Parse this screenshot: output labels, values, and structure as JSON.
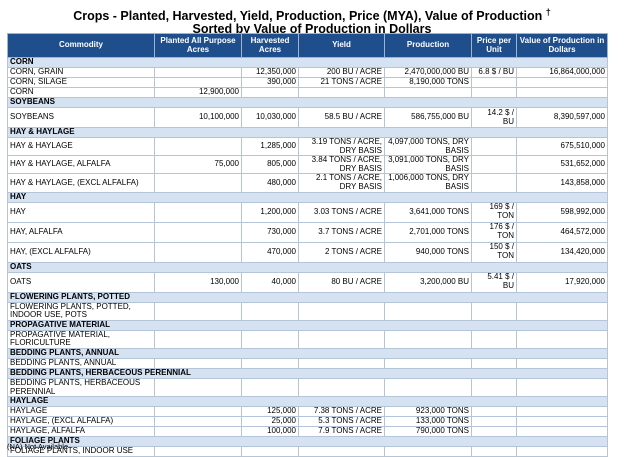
{
  "title_line1": "Crops - Planted, Harvested, Yield, Production, Price (MYA), Value of Production",
  "title_mark": "†",
  "title_line2": "Sorted by Value of Production in Dollars",
  "columns": [
    "Commodity",
    "Planted All Purpose Acres",
    "Harvested Acres",
    "Yield",
    "Production",
    "Price per Unit",
    "Value of Production in Dollars"
  ],
  "rows": [
    {
      "type": "section",
      "label": "CORN"
    },
    {
      "type": "data",
      "h": "h9",
      "cells": [
        "CORN, GRAIN",
        "",
        "12,350,000",
        "200 BU / ACRE",
        "2,470,000,000 BU",
        "6.8 $ / BU",
        "16,864,000,000"
      ]
    },
    {
      "type": "data",
      "h": "h9",
      "cells": [
        "CORN, SILAGE",
        "",
        "390,000",
        "21 TONS / ACRE",
        "8,190,000 TONS",
        "",
        ""
      ]
    },
    {
      "type": "data",
      "h": "h9",
      "cells": [
        "CORN",
        "12,900,000",
        "",
        "",
        "",
        "",
        ""
      ]
    },
    {
      "type": "section",
      "label": "SOYBEANS"
    },
    {
      "type": "data",
      "h": "h19",
      "cells": [
        "SOYBEANS",
        "10,100,000",
        "10,030,000",
        "58.5 BU / ACRE",
        "586,755,000 BU",
        "14.2 $ / BU",
        "8,390,597,000"
      ]
    },
    {
      "type": "section",
      "label": "HAY & HAYLAGE"
    },
    {
      "type": "data",
      "h": "h16",
      "cells": [
        "HAY & HAYLAGE",
        "",
        "1,285,000",
        "3.19 TONS / ACRE, DRY BASIS",
        "4,097,000 TONS, DRY BASIS",
        "",
        "675,510,000"
      ]
    },
    {
      "type": "data",
      "h": "h16",
      "cells": [
        "HAY & HAYLAGE, ALFALFA",
        "75,000",
        "805,000",
        "3.84 TONS / ACRE, DRY BASIS",
        "3,091,000 TONS, DRY BASIS",
        "",
        "531,652,000"
      ]
    },
    {
      "type": "data",
      "h": "h16",
      "cells": [
        "HAY & HAYLAGE, (EXCL ALFALFA)",
        "",
        "480,000",
        "2.1 TONS / ACRE, DRY BASIS",
        "1,006,000 TONS, DRY BASIS",
        "",
        "143,858,000"
      ]
    },
    {
      "type": "section",
      "label": "HAY"
    },
    {
      "type": "data",
      "h": "h19",
      "cells": [
        "HAY",
        "",
        "1,200,000",
        "3.03 TONS / ACRE",
        "3,641,000 TONS",
        "169 $ / TON",
        "598,992,000"
      ]
    },
    {
      "type": "data",
      "h": "h19",
      "cells": [
        "HAY, ALFALFA",
        "",
        "730,000",
        "3.7 TONS / ACRE",
        "2,701,000 TONS",
        "176 $ / TON",
        "464,572,000"
      ]
    },
    {
      "type": "data",
      "h": "h19",
      "cells": [
        "HAY, (EXCL ALFALFA)",
        "",
        "470,000",
        "2 TONS / ACRE",
        "940,000 TONS",
        "150 $ / TON",
        "134,420,000"
      ]
    },
    {
      "type": "section",
      "label": "OATS"
    },
    {
      "type": "data",
      "h": "h19",
      "cells": [
        "OATS",
        "130,000",
        "40,000",
        "80 BU / ACRE",
        "3,200,000 BU",
        "5.41 $ / BU",
        "17,920,000"
      ]
    },
    {
      "type": "section",
      "label": "FLOWERING PLANTS, POTTED"
    },
    {
      "type": "data",
      "h": "h16",
      "cells": [
        "FLOWERING PLANTS, POTTED, INDOOR USE, POTS",
        "",
        "",
        "",
        "",
        "",
        ""
      ]
    },
    {
      "type": "section",
      "label": "PROPAGATIVE MATERIAL"
    },
    {
      "type": "data",
      "h": "h16",
      "cells": [
        "PROPAGATIVE MATERIAL, FLORICULTURE",
        "",
        "",
        "",
        "",
        "",
        ""
      ]
    },
    {
      "type": "section",
      "label": "BEDDING PLANTS, ANNUAL"
    },
    {
      "type": "data",
      "h": "h9",
      "cells": [
        "BEDDING PLANTS, ANNUAL",
        "",
        "",
        "",
        "",
        "",
        ""
      ]
    },
    {
      "type": "section",
      "label": "BEDDING PLANTS, HERBACEOUS PERENNIAL"
    },
    {
      "type": "data",
      "h": "h16",
      "cells": [
        "BEDDING PLANTS, HERBACEOUS PERENNIAL",
        "",
        "",
        "",
        "",
        "",
        ""
      ]
    },
    {
      "type": "section",
      "label": "HAYLAGE"
    },
    {
      "type": "data",
      "h": "h9",
      "cells": [
        "HAYLAGE",
        "",
        "125,000",
        "7.38 TONS / ACRE",
        "923,000 TONS",
        "",
        ""
      ]
    },
    {
      "type": "data",
      "h": "h9",
      "cells": [
        "HAYLAGE, (EXCL ALFALFA)",
        "",
        "25,000",
        "5.3 TONS / ACRE",
        "133,000 TONS",
        "",
        ""
      ]
    },
    {
      "type": "data",
      "h": "h9",
      "cells": [
        "HAYLAGE, ALFALFA",
        "",
        "100,000",
        "7.9 TONS / ACRE",
        "790,000 TONS",
        "",
        ""
      ]
    },
    {
      "type": "section",
      "label": "FOLIAGE PLANTS"
    },
    {
      "type": "data",
      "h": "h9",
      "cells": [
        "FOLIAGE PLANTS, INDOOR USE",
        "",
        "",
        "",
        "",
        "",
        ""
      ]
    }
  ],
  "footnote": "(NA) Not Available"
}
